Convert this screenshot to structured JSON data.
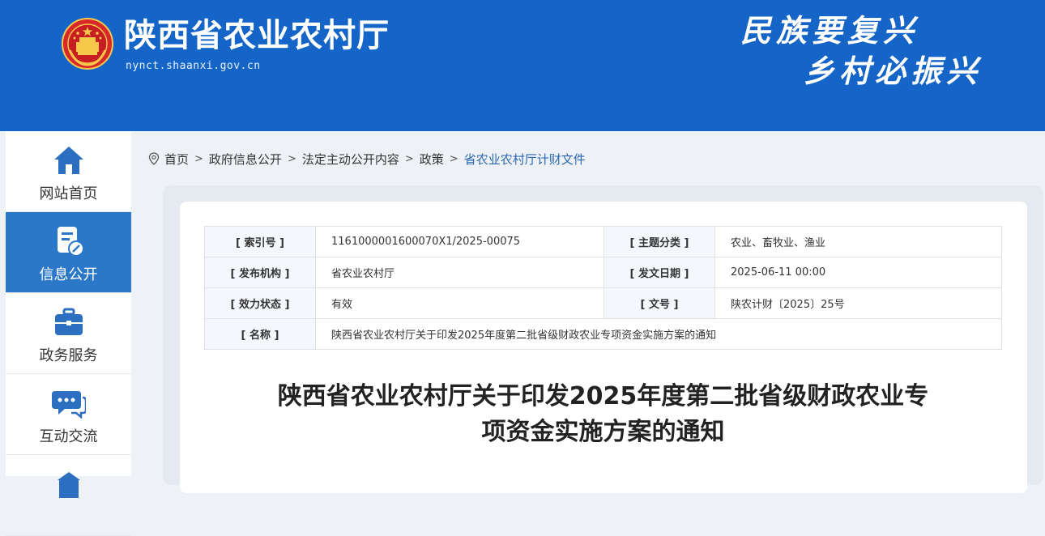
{
  "header": {
    "site_name": "陕西省农业农村厅",
    "site_url": "nynct.shaanxi.gov.cn",
    "slogan_line1": "民族要复兴",
    "slogan_line2": "乡村必振兴"
  },
  "leftnav": {
    "items": [
      {
        "label": "网站首页",
        "icon": "home-icon",
        "active": false
      },
      {
        "label": "信息公开",
        "icon": "document-info-icon",
        "active": true
      },
      {
        "label": "政务服务",
        "icon": "briefcase-icon",
        "active": false
      },
      {
        "label": "互动交流",
        "icon": "chat-bubbles-icon",
        "active": false
      }
    ]
  },
  "breadcrumb": {
    "icon": "location-pin-icon",
    "items": [
      "首页",
      "政府信息公开",
      "法定主动公开内容",
      "政策",
      "省农业农村厅计财文件"
    ],
    "separator": ">"
  },
  "meta": {
    "index_label": "[ 索引号 ]",
    "index_value": "1161000001600070X1/2025-00075",
    "topic_label": "[ 主题分类 ]",
    "topic_value": "农业、畜牧业、渔业",
    "publisher_label": "[ 发布机构 ]",
    "publisher_value": "省农业农村厅",
    "date_label": "[ 发文日期 ]",
    "date_value": "2025-06-11 00:00",
    "status_label": "[ 效力状态 ]",
    "status_value": "有效",
    "docno_label": "[ 文号 ]",
    "docno_value": "陕农计财〔2025〕25号",
    "name_label": "[ 名称 ]",
    "name_value": "陕西省农业农村厅关于印发2025年度第二批省级财政农业专项资金实施方案的通知"
  },
  "document": {
    "title_line1": "陕西省农业农村厅关于印发2025年度第二批省级财政农业专",
    "title_line2": "项资金实施方案的通知"
  },
  "colors": {
    "header_bg": "#1565c8",
    "nav_active_bg": "#2c78c8",
    "link_blue": "#2a68b1",
    "status_green": "#2e8a2e"
  }
}
